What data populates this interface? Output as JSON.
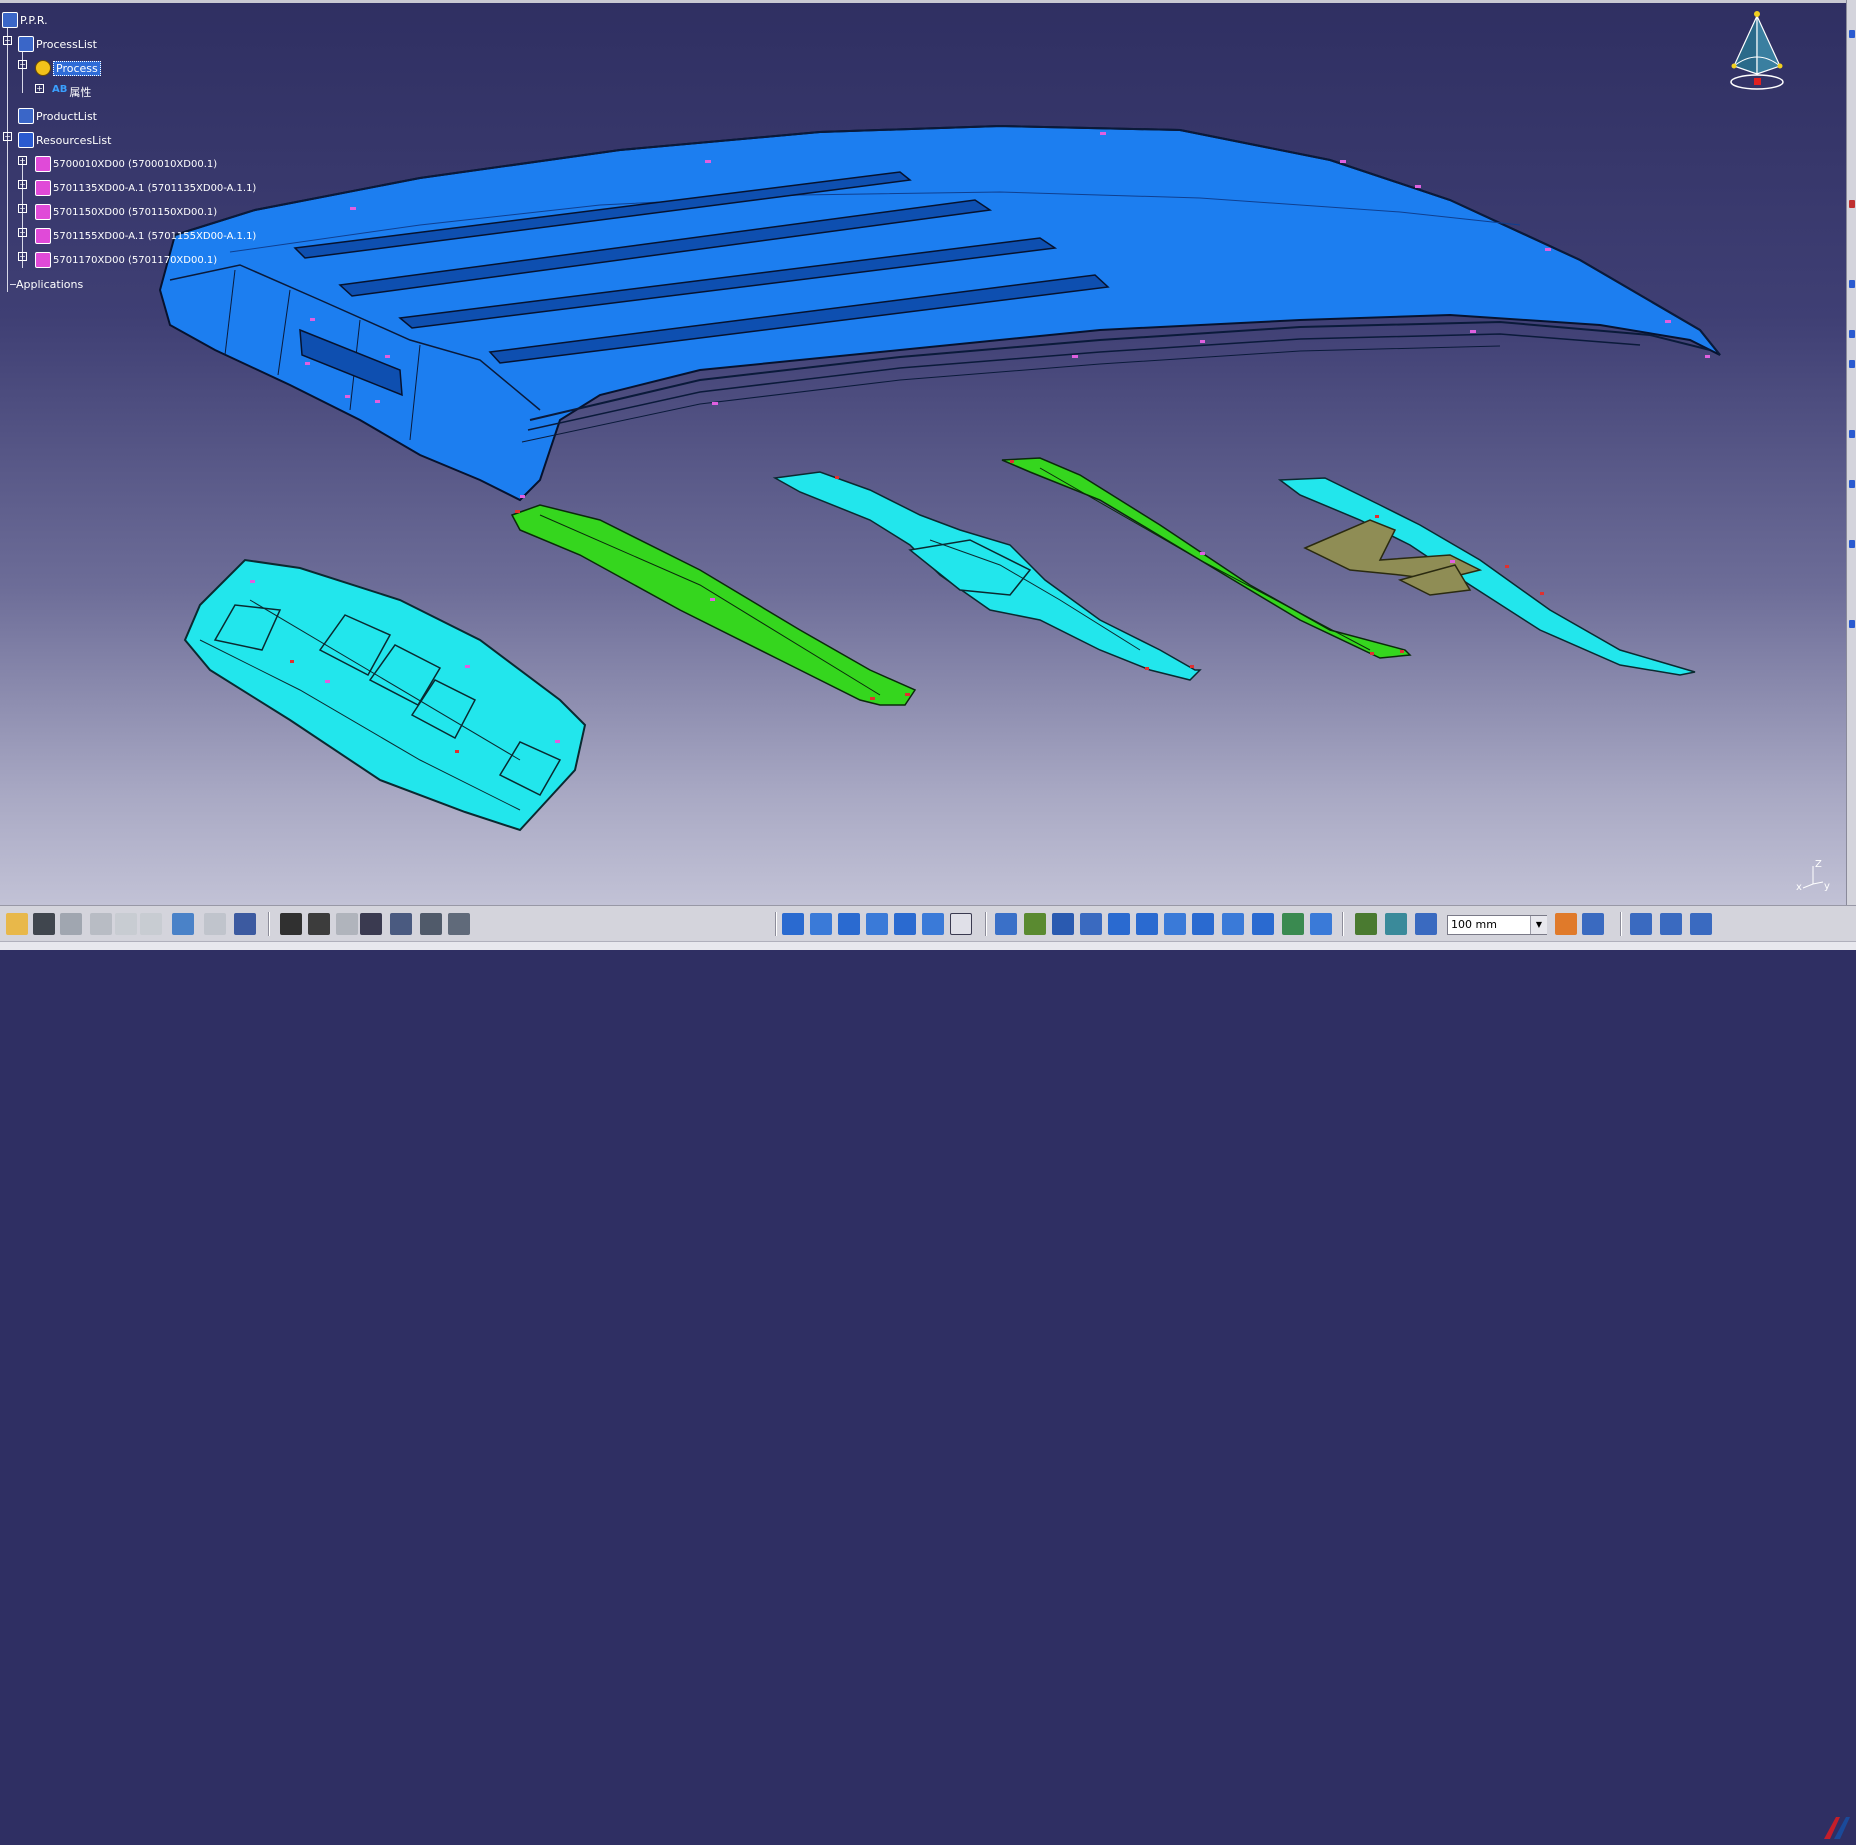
{
  "tree": {
    "root": "P.P.R.",
    "processlist": "ProcessList",
    "process": "Process",
    "attr_icon_text": "AB",
    "attr": "属性",
    "productlist": "ProductList",
    "resourceslist": "ResourcesList",
    "resources": [
      "5700010XD00 (5700010XD00.1)",
      "5701135XD00-A.1 (5701135XD00-A.1.1)",
      "5701150XD00 (5701150XD00.1)",
      "5701155XD00-A.1 (5701155XD00-A.1.1)",
      "5701170XD00 (5701170XD00.1)"
    ],
    "applications": "Applications"
  },
  "axis": {
    "z": "Z",
    "x": "x",
    "y": "y"
  },
  "toolbar": {
    "zoom_value": "100 mm",
    "icons": [
      "open-icon",
      "save-icon",
      "print-icon",
      "cut-icon",
      "copy-icon",
      "paste-icon",
      "undo-icon",
      "redo-icon",
      "whats-this-icon",
      "formula-icon",
      "comment-icon",
      "link-icon",
      "table-icon",
      "tree-icon",
      "catalog-icon",
      "measure-icon",
      "cylinder-1-icon",
      "cylinder-2-icon",
      "cylinder-3-icon",
      "cylinder-4-icon",
      "cylinder-5-icon",
      "cylinder-6-icon",
      "help-icon",
      "fly-icon",
      "fit-all-icon",
      "pan-icon",
      "rotate-icon",
      "zoom-in-icon",
      "zoom-out-icon",
      "normal-view-icon",
      "multi-view-icon",
      "iso-view-icon",
      "shading-icon",
      "hide-show-icon",
      "swap-icon",
      "compass-icon",
      "snap-icon",
      "section-icon",
      "manipulate-icon",
      "analysis-icon",
      "tools-icon",
      "options-icon"
    ]
  },
  "colors": {
    "roof": "#1c7ef0",
    "cyan_parts": "#22e6ec",
    "green_parts": "#35d61e",
    "olive_parts": "#8f8d55",
    "bg_top": "#2f2f62",
    "bg_bottom": "#c2c2d6"
  }
}
